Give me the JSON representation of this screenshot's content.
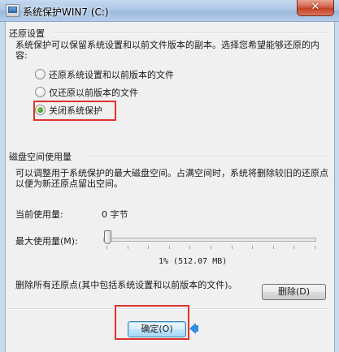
{
  "window": {
    "title": "系统保护WIN7 (C:)",
    "close_symbol": "✕"
  },
  "restore_settings": {
    "section_label": "还原设置",
    "description": "系统保护可以保留系统设置和以前文件版本的副本。选择您希望能够还原的内容:",
    "options": [
      {
        "label": "还原系统设置和以前版本的文件",
        "checked": false
      },
      {
        "label": "仅还原以前版本的文件",
        "checked": false
      },
      {
        "label": "关闭系统保护",
        "checked": true
      }
    ]
  },
  "disk_usage": {
    "section_label": "磁盘空间使用量",
    "description": "可以调整用于系统保护的最大磁盘空间。占满空间时，系统将删除较旧的还原点以便为新还原点留出空间。",
    "current_label": "当前使用量:",
    "current_value": "0 字节",
    "max_label": "最大使用量(M):",
    "max_value_text": "1% (512.07 MB)",
    "slider_percent": 1
  },
  "delete": {
    "text": "删除所有还原点(其中包括系统设置和以前版本的文件)。",
    "button_label": "删除(D)"
  },
  "footer": {
    "ok_label": "确定(O)"
  },
  "colors": {
    "highlight": "#e0332b",
    "arrow": "#2f8ee0"
  }
}
